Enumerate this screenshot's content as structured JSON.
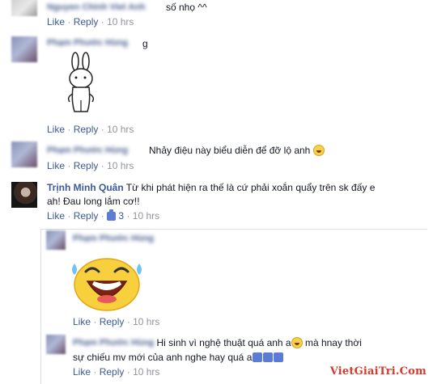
{
  "comments": [
    {
      "text_suffix": "số nhọ ^^",
      "actions": {
        "like": "Like",
        "reply": "Reply",
        "time": "10 hrs"
      }
    },
    {
      "text": "g",
      "sticker": "bunny-sticker",
      "actions": {
        "like": "Like",
        "reply": "Reply",
        "time": "10 hrs"
      }
    },
    {
      "text": "Nhảy điệu này biểu diễn để đỡ lộ anh",
      "actions": {
        "like": "Like",
        "reply": "Reply",
        "time": "10 hrs"
      }
    },
    {
      "author": "Trịnh Minh Quân",
      "text_line1": "Từ khi phát hiện ra thế là cứ phải xoắn quẩy trên sk đấy e",
      "text_line2": "ah! Đau long lắm cơ!!",
      "actions": {
        "like": "Like",
        "reply": "Reply",
        "likes": "3",
        "time": "10 hrs"
      }
    }
  ],
  "replies": [
    {
      "sticker": "laughing-emoji-sticker",
      "actions": {
        "like": "Like",
        "reply": "Reply",
        "time": "10 hrs"
      }
    },
    {
      "text_line1": "Hi sinh vì nghệ thuật quá anh a",
      "text_line1_end": "mà hnay thời",
      "text_line2": "sự chiếu mv mới của anh nghe hay quá a",
      "actions": {
        "like": "Like",
        "reply": "Reply",
        "time": "10 hrs"
      }
    }
  ],
  "watermark": {
    "text": "VietGiaiTri.Com"
  },
  "colors": {
    "link": "#3b5998",
    "meta": "#90949c",
    "watermark": "#d33a2c"
  }
}
